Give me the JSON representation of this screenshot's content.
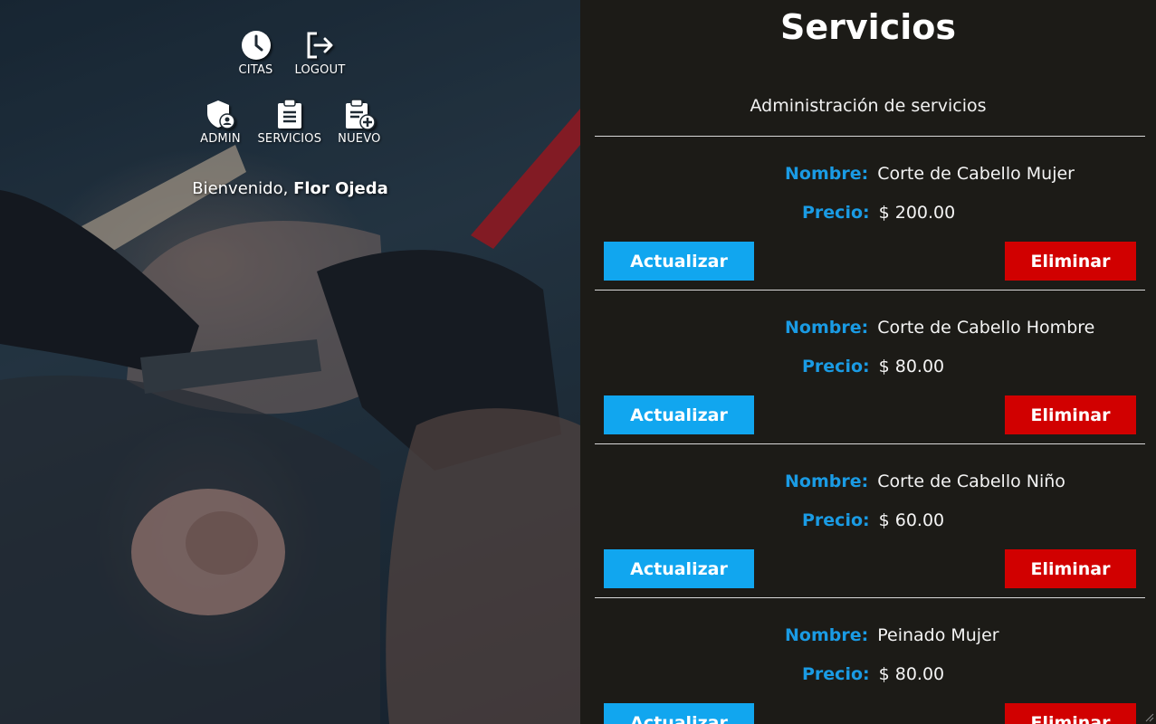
{
  "nav": {
    "items_row1": [
      {
        "label": "CITAS",
        "icon": "clock-icon"
      },
      {
        "label": "LOGOUT",
        "icon": "logout-icon"
      }
    ],
    "items_row2": [
      {
        "label": "ADMIN",
        "icon": "shield-user-icon"
      },
      {
        "label": "SERVICIOS",
        "icon": "clipboard-list-icon"
      },
      {
        "label": "NUEVO",
        "icon": "clipboard-add-icon"
      }
    ]
  },
  "welcome": {
    "prefix": "Bienvenido,",
    "user": "Flor Ojeda"
  },
  "panel": {
    "title": "Servicios",
    "subtitle": "Administración de servicios"
  },
  "labels": {
    "name_key": "Nombre:",
    "price_key": "Precio:",
    "update": "Actualizar",
    "delete": "Eliminar"
  },
  "services": [
    {
      "name": "Corte de Cabello Mujer",
      "price": "$ 200.00"
    },
    {
      "name": "Corte de Cabello Hombre",
      "price": "$ 80.00"
    },
    {
      "name": "Corte de Cabello Niño",
      "price": "$ 60.00"
    },
    {
      "name": "Peinado Mujer",
      "price": "$ 80.00"
    }
  ],
  "colors": {
    "panel_bg": "#1c1b17",
    "accent_blue": "#1a9be4",
    "update_button": "#11a6ef",
    "delete_button": "#d10000"
  }
}
